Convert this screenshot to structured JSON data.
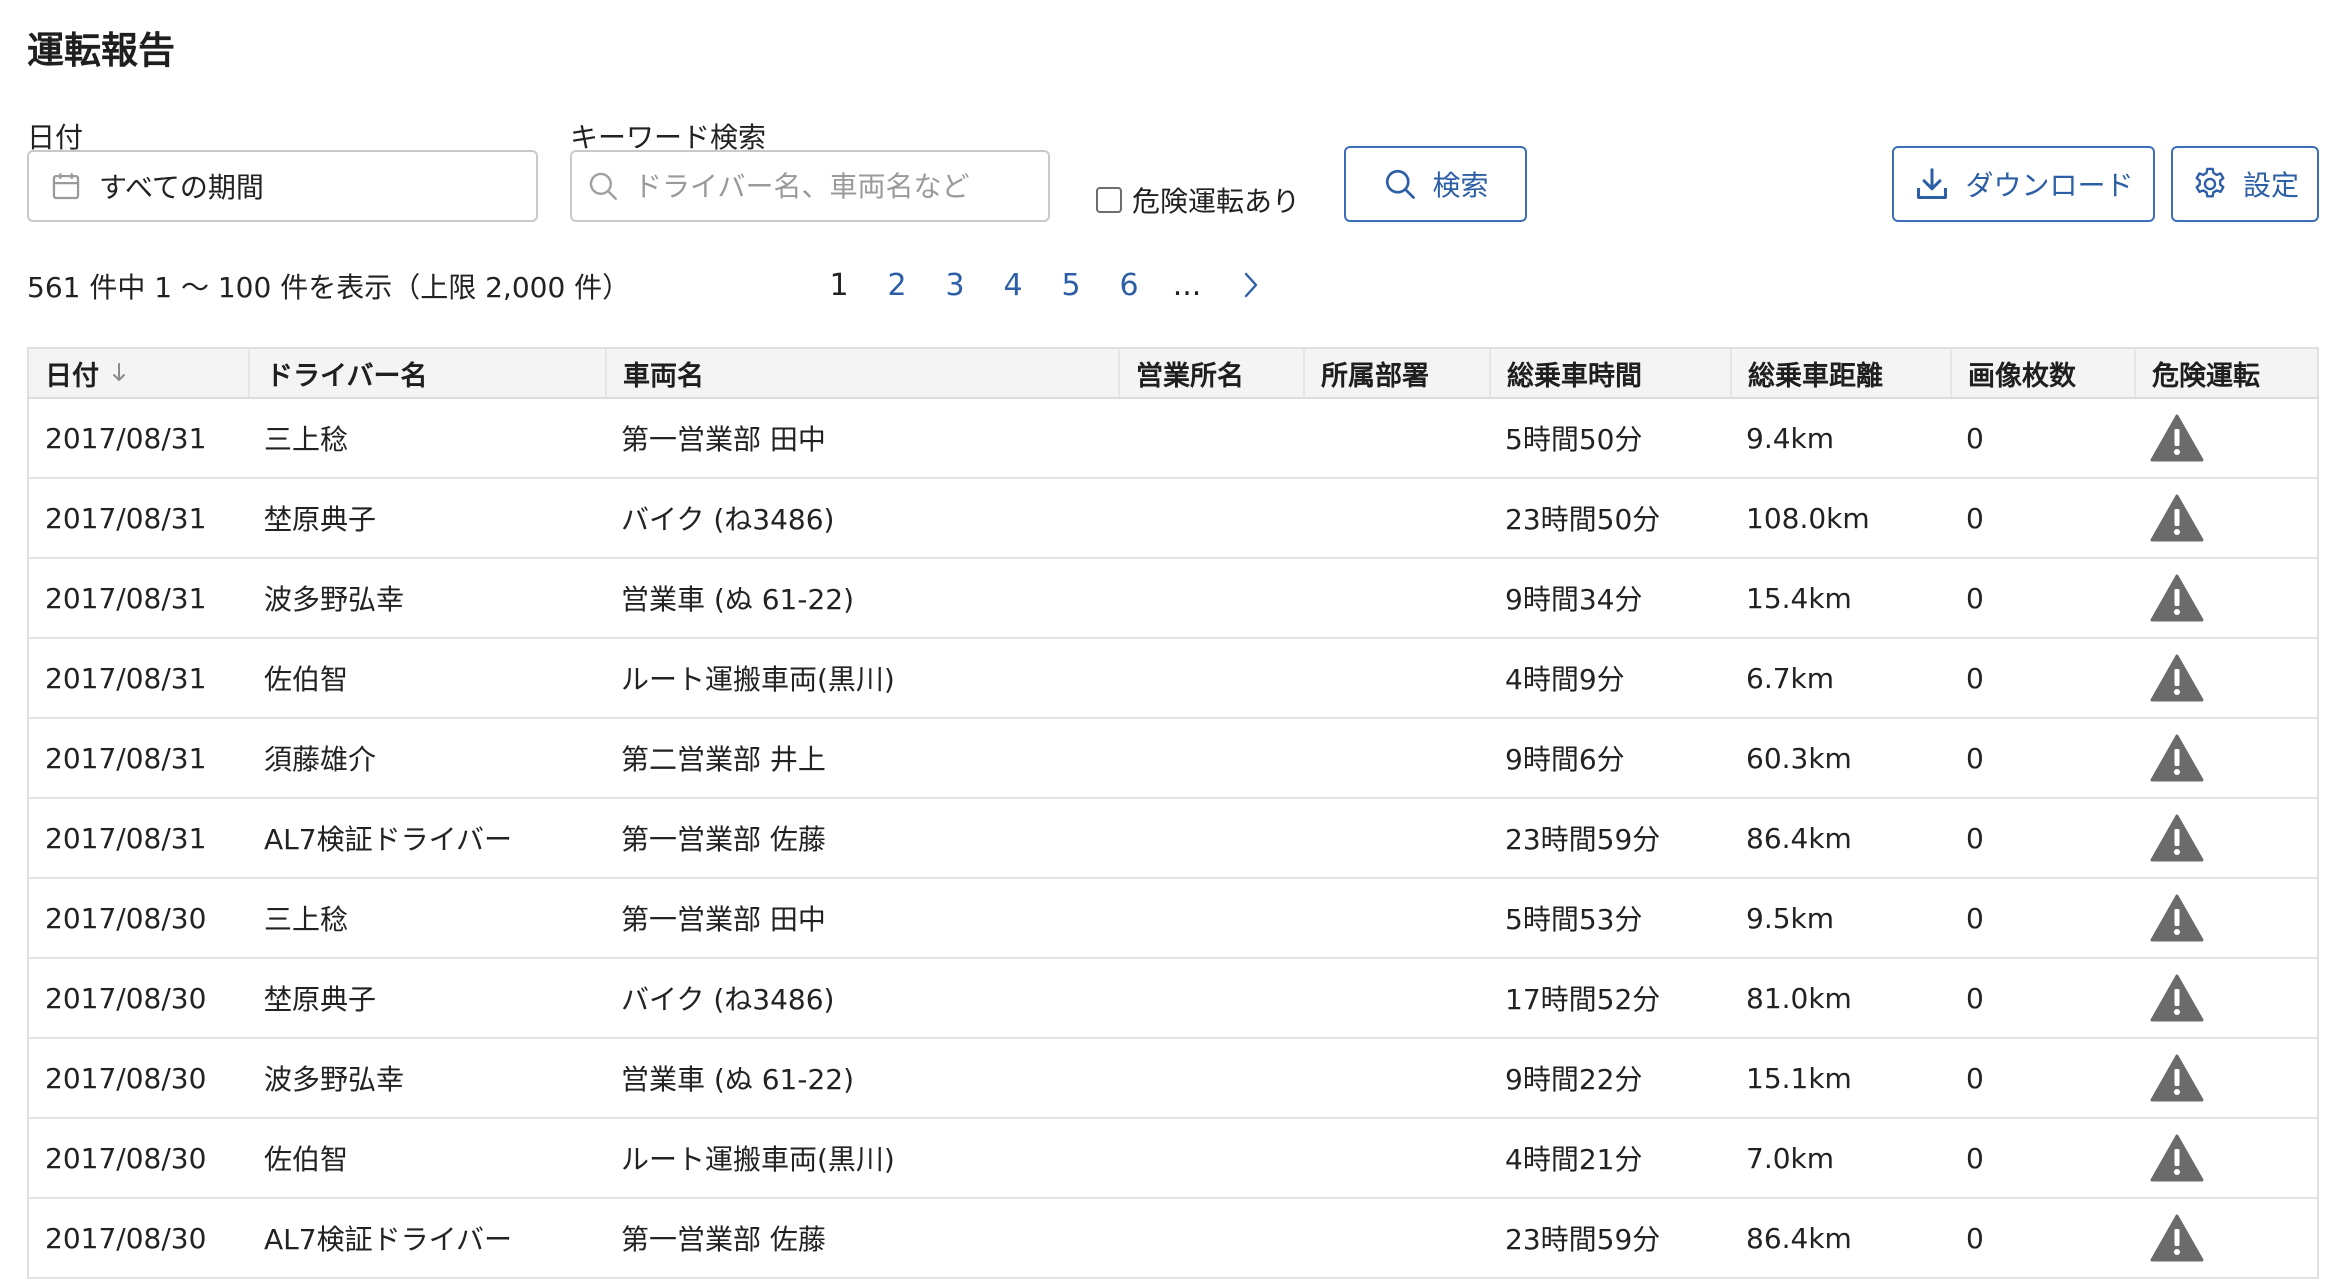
{
  "page": {
    "title": "運転報告"
  },
  "filters": {
    "date_label": "日付",
    "date_value": "すべての期間",
    "keyword_label": "キーワード検索",
    "keyword_placeholder": "ドライバー名、車両名など",
    "keyword_value": "",
    "danger_checkbox_label": "危険運転あり",
    "danger_checked": false,
    "search_button": "検索",
    "download_button": "ダウンロード",
    "settings_button": "設定"
  },
  "results": {
    "summary": "561 件中 1 〜 100 件を表示（上限 2,000 件）",
    "pages": [
      "1",
      "2",
      "3",
      "4",
      "5",
      "6"
    ],
    "current_page": "1",
    "ellipsis": "..."
  },
  "table": {
    "columns": [
      "日付",
      "ドライバー名",
      "車両名",
      "営業所名",
      "所属部署",
      "総乗車時間",
      "総乗車距離",
      "画像枚数",
      "危険運転"
    ],
    "sorted_column": "日付",
    "sort_direction": "descending",
    "rows": [
      {
        "date": "2017/08/31",
        "driver": "三上稔",
        "vehicle": "第一営業部 田中",
        "office": "",
        "dept": "",
        "time": "5時間50分",
        "distance": "9.4km",
        "images": "0",
        "danger_icon": "warning-triangle"
      },
      {
        "date": "2017/08/31",
        "driver": "埜原典子",
        "vehicle": "バイク (ね3486)",
        "office": "",
        "dept": "",
        "time": "23時間50分",
        "distance": "108.0km",
        "images": "0",
        "danger_icon": "warning-triangle"
      },
      {
        "date": "2017/08/31",
        "driver": "波多野弘幸",
        "vehicle": "営業車 (ぬ 61-22)",
        "office": "",
        "dept": "",
        "time": "9時間34分",
        "distance": "15.4km",
        "images": "0",
        "danger_icon": "warning-triangle"
      },
      {
        "date": "2017/08/31",
        "driver": "佐伯智",
        "vehicle": "ルート運搬車両(黒川)",
        "office": "",
        "dept": "",
        "time": "4時間9分",
        "distance": "6.7km",
        "images": "0",
        "danger_icon": "warning-triangle"
      },
      {
        "date": "2017/08/31",
        "driver": "須藤雄介",
        "vehicle": "第二営業部 井上",
        "office": "",
        "dept": "",
        "time": "9時間6分",
        "distance": "60.3km",
        "images": "0",
        "danger_icon": "warning-triangle"
      },
      {
        "date": "2017/08/31",
        "driver": "AL7検証ドライバー",
        "vehicle": "第一営業部 佐藤",
        "office": "",
        "dept": "",
        "time": "23時間59分",
        "distance": "86.4km",
        "images": "0",
        "danger_icon": "warning-triangle"
      },
      {
        "date": "2017/08/30",
        "driver": "三上稔",
        "vehicle": "第一営業部 田中",
        "office": "",
        "dept": "",
        "time": "5時間53分",
        "distance": "9.5km",
        "images": "0",
        "danger_icon": "warning-triangle"
      },
      {
        "date": "2017/08/30",
        "driver": "埜原典子",
        "vehicle": "バイク (ね3486)",
        "office": "",
        "dept": "",
        "time": "17時間52分",
        "distance": "81.0km",
        "images": "0",
        "danger_icon": "warning-triangle"
      },
      {
        "date": "2017/08/30",
        "driver": "波多野弘幸",
        "vehicle": "営業車 (ぬ 61-22)",
        "office": "",
        "dept": "",
        "time": "9時間22分",
        "distance": "15.1km",
        "images": "0",
        "danger_icon": "warning-triangle"
      },
      {
        "date": "2017/08/30",
        "driver": "佐伯智",
        "vehicle": "ルート運搬車両(黒川)",
        "office": "",
        "dept": "",
        "time": "4時間21分",
        "distance": "7.0km",
        "images": "0",
        "danger_icon": "warning-triangle"
      },
      {
        "date": "2017/08/30",
        "driver": "AL7検証ドライバー",
        "vehicle": "第一営業部 佐藤",
        "office": "",
        "dept": "",
        "time": "23時間59分",
        "distance": "86.4km",
        "images": "0",
        "danger_icon": "warning-triangle"
      }
    ]
  },
  "colors": {
    "accent": "#2d5fa6",
    "border": "#c9c9c9",
    "header_bg": "#f4f4f4",
    "warning_icon": "#6b6b6b"
  }
}
